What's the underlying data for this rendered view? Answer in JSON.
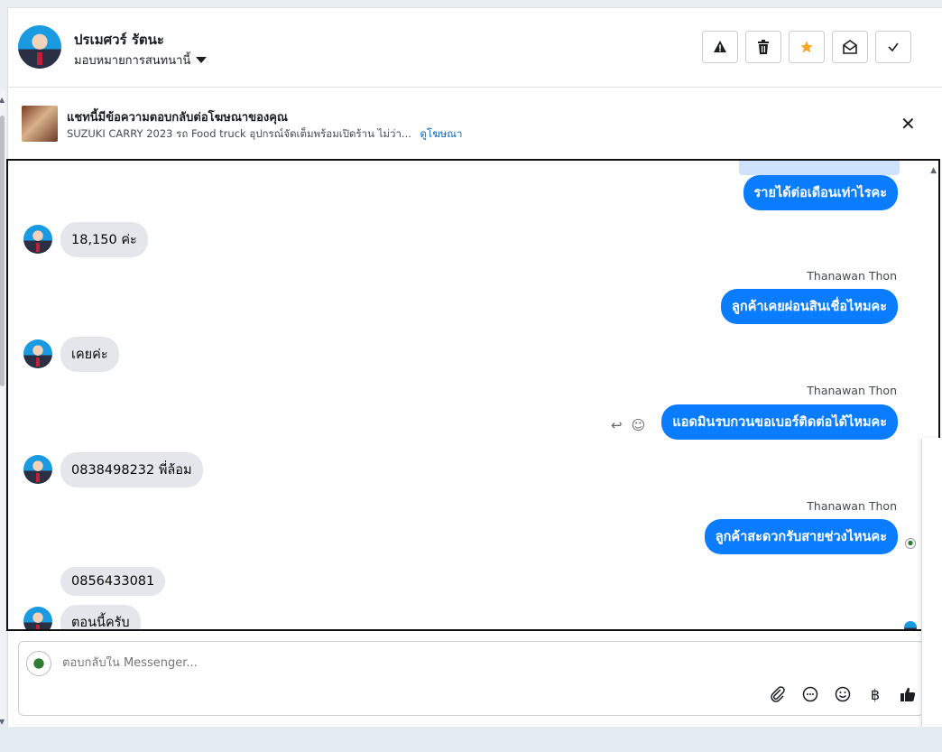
{
  "header": {
    "name": "ปรเมศวร์ รัตนะ",
    "assign_label": "มอบหมายการสนทนานี้",
    "actions": [
      {
        "icon": "alert-icon"
      },
      {
        "icon": "trash-icon"
      },
      {
        "icon": "star-icon",
        "color": "#f5a623"
      },
      {
        "icon": "envelope-open-icon"
      },
      {
        "icon": "check-icon"
      }
    ]
  },
  "ad_banner": {
    "title": "แชทนี้มีข้อความตอบกลับต่อโฆษณาของคุณ",
    "subtitle": "SUZUKI CARRY 2023 รถ Food truck อุปกรณ์จัดเต็มพร้อมเปิดร้าน ไม่ว่า...",
    "link": "ดูโฆษณา"
  },
  "messages": [
    {
      "dir": "out",
      "text": "รายได้ต่อเดือนเท่าไรคะ"
    },
    {
      "dir": "in",
      "text": "18,150 ค่ะ"
    },
    {
      "dir": "out",
      "sender": "Thanawan Thon",
      "text": "ลูกค้าเคยผ่อนสินเชื่อไหมคะ"
    },
    {
      "dir": "in",
      "text": "เคยค่ะ"
    },
    {
      "dir": "out",
      "sender": "Thanawan Thon",
      "text": "แอดมินรบกวนขอเบอร์ติดต่อได้ไหมคะ"
    },
    {
      "dir": "in",
      "text": "0838498232 พี่ล้อม"
    },
    {
      "dir": "out",
      "sender": "Thanawan Thon",
      "text": "ลูกค้าสะดวกรับสายช่วงไหนคะ"
    },
    {
      "dir": "in",
      "text": "0856433081"
    },
    {
      "dir": "in",
      "text": "ตอนนี้ครับ"
    }
  ],
  "composer": {
    "placeholder": "ตอบกลับใน Messenger...",
    "tools": [
      "paperclip-icon",
      "chat-bubble-icon",
      "emoji-icon",
      "baht-icon",
      "thumbs-up-icon"
    ],
    "baht_symbol": "฿"
  },
  "colors": {
    "outgoing_bubble": "#0a7cff",
    "incoming_bubble": "#e4e6eb",
    "link": "#0a66c2"
  }
}
